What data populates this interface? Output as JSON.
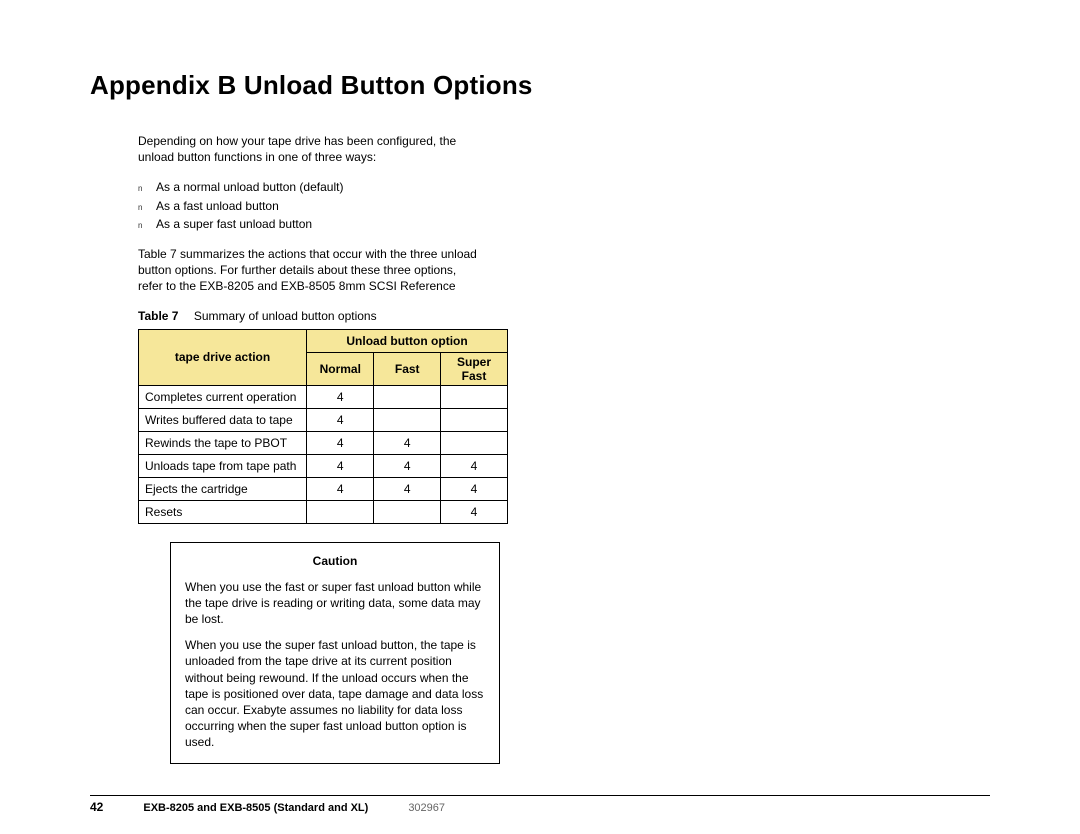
{
  "title": "Appendix B  Unload Button Options",
  "intro": "Depending on how your tape drive has been configured, the unload button functions in one of three ways:",
  "bullets": [
    "As a  normal  unload button (default)",
    "As a  fast  unload button",
    "As a  super fast  unload button"
  ],
  "summary": "Table 7 summarizes the actions that occur with the three unload button options. For further details about these three options, refer to the EXB-8205 and EXB-8505 8mm SCSI Reference",
  "chart_data": {
    "type": "table",
    "caption_label": "Table 7",
    "caption_text": "Summary of unload button options",
    "header_left": "tape drive action",
    "header_right": "Unload button option",
    "columns": [
      "Normal",
      "Fast",
      "Super Fast"
    ],
    "rows": [
      {
        "action": "Completes current operation",
        "normal": "4",
        "fast": "",
        "super": ""
      },
      {
        "action": "Writes buffered data to tape",
        "normal": "4",
        "fast": "",
        "super": ""
      },
      {
        "action": "Rewinds the tape to PBOT",
        "normal": "4",
        "fast": "4",
        "super": ""
      },
      {
        "action": "Unloads tape from tape path",
        "normal": "4",
        "fast": "4",
        "super": "4"
      },
      {
        "action": "Ejects the cartridge",
        "normal": "4",
        "fast": "4",
        "super": "4"
      },
      {
        "action": "Resets",
        "normal": "",
        "fast": "",
        "super": "4"
      }
    ]
  },
  "caution": {
    "title": "Caution",
    "p1": "When you use the  fast  or  super fast  unload button while the tape drive is reading or writing data, some data may be lost.",
    "p2": "When you use the  super fast  unload button, the tape is unloaded from the tape drive at its current position without being rewound. If the unload occurs when the tape is positioned over data, tape damage and data loss can occur. Exabyte assumes no liability for data loss occurring when the  super fast  unload button option is used."
  },
  "footer": {
    "page": "42",
    "doc": "EXB-8205 and EXB-8505 (Standard and XL)",
    "rev": "302967"
  }
}
